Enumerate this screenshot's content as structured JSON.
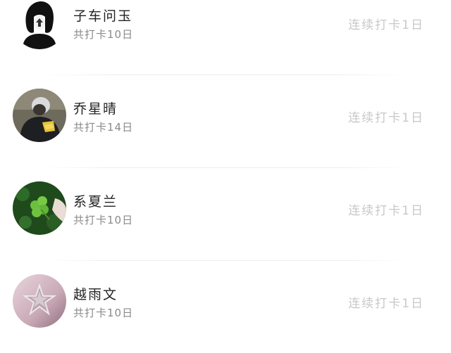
{
  "checkin_list": {
    "items": [
      {
        "name": "子车问玉",
        "total_checkins": "共打卡10日",
        "streak": "连续打卡1日",
        "avatar_icon": "silhouette-hair-avatar"
      },
      {
        "name": "乔星晴",
        "total_checkins": "共打卡14日",
        "streak": "连续打卡1日",
        "avatar_icon": "person-hoodie-avatar"
      },
      {
        "name": "系夏兰",
        "total_checkins": "共打卡10日",
        "streak": "连续打卡1日",
        "avatar_icon": "clover-leaf-avatar"
      },
      {
        "name": "越雨文",
        "total_checkins": "共打卡10日",
        "streak": "连续打卡1日",
        "avatar_icon": "star-ornament-avatar"
      }
    ]
  }
}
